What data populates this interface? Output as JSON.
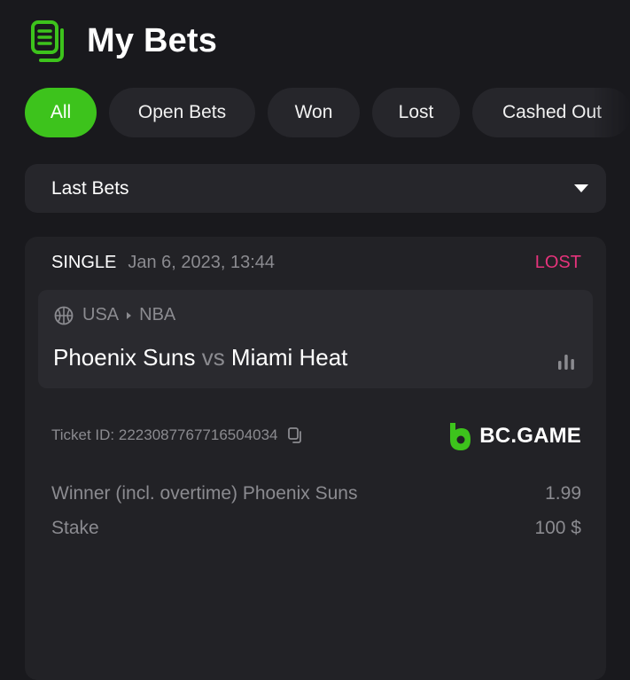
{
  "header": {
    "title": "My Bets",
    "icon": "bets-list-icon",
    "accent_color": "#3dc31c"
  },
  "filters": [
    {
      "label": "All",
      "active": true
    },
    {
      "label": "Open Bets",
      "active": false
    },
    {
      "label": "Won",
      "active": false
    },
    {
      "label": "Lost",
      "active": false
    },
    {
      "label": "Cashed Out",
      "active": false
    }
  ],
  "period_select": {
    "selected": "Last Bets"
  },
  "bet": {
    "type": "SINGLE",
    "date": "Jan 6, 2023, 13:44",
    "status": "LOST",
    "status_color": "#e5337b",
    "event": {
      "country": "USA",
      "league": "NBA",
      "home": "Phoenix Suns",
      "vs": "vs",
      "away": "Miami Heat"
    },
    "ticket_label": "Ticket ID: 2223087767716504034",
    "brand": "BC.GAME",
    "market": "Winner (incl. overtime) Phoenix Suns",
    "odds": "1.99",
    "stake_label": "Stake",
    "stake_value": "100 $"
  }
}
